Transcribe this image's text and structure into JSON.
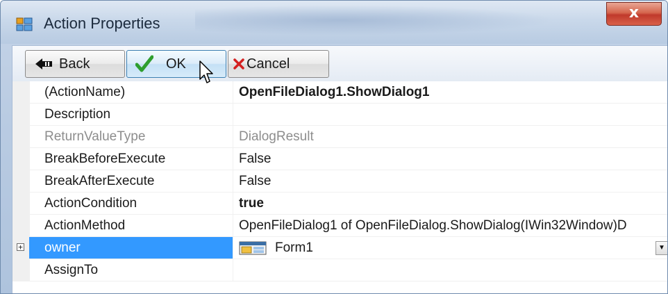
{
  "window": {
    "title": "Action Properties",
    "close_label": "x"
  },
  "toolbar": {
    "back_label": "Back",
    "ok_label": "OK",
    "cancel_label": "Cancel"
  },
  "properties": [
    {
      "name": "(ActionName)",
      "value": "OpenFileDialog1.ShowDialog1",
      "style": "bold"
    },
    {
      "name": "Description",
      "value": "",
      "style": "normal"
    },
    {
      "name": "ReturnValueType",
      "value": "DialogResult",
      "style": "muted"
    },
    {
      "name": "BreakBeforeExecute",
      "value": "False",
      "style": "normal"
    },
    {
      "name": "BreakAfterExecute",
      "value": "False",
      "style": "normal"
    },
    {
      "name": "ActionCondition",
      "value": "true",
      "style": "bold"
    },
    {
      "name": "ActionMethod",
      "value": "OpenFileDialog1 of OpenFileDialog.ShowDialog(IWin32Window)D",
      "style": "normal"
    },
    {
      "name": "owner",
      "value": "Form1",
      "style": "selected",
      "expandable": true,
      "expander_glyph": "+"
    },
    {
      "name": "AssignTo",
      "value": "",
      "style": "normal"
    }
  ],
  "colors": {
    "selection": "#3399ff",
    "ok_check": "#2e9e2e",
    "cancel_x": "#d42020"
  },
  "icons": {
    "app": "property-grid-icon",
    "back": "back-arrow-icon",
    "ok": "checkmark-icon",
    "cancel": "red-x-icon",
    "owner_value": "form-window-icon",
    "dropdown": "chevron-down-icon",
    "cursor": "mouse-pointer-icon"
  }
}
